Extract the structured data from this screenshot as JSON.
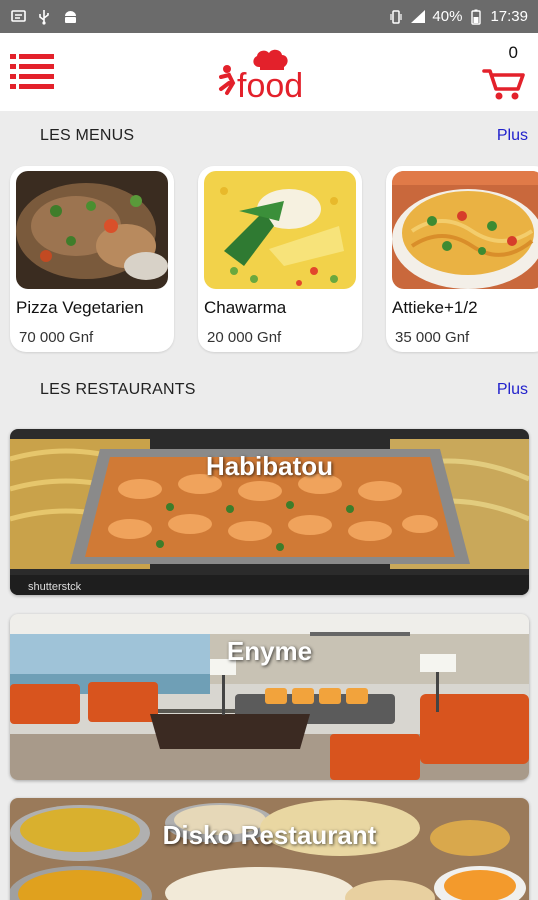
{
  "status_bar": {
    "battery": "40%",
    "time": "17:39"
  },
  "header": {
    "logo_text": "food",
    "cart_count": "0"
  },
  "sections": {
    "menus_title": "LES MENUS",
    "menus_more": "Plus",
    "restaurants_title": "LES RESTAURANTS",
    "restaurants_more": "Plus"
  },
  "menus": [
    {
      "name": "Pizza Vegetarien",
      "price": "70 000 Gnf"
    },
    {
      "name": "Chawarma",
      "price": "20 000 Gnf"
    },
    {
      "name": "Attieke+1/2",
      "price": "35 000 Gnf"
    }
  ],
  "restaurants": [
    {
      "name": "Habibatou",
      "watermark": "shutterstck"
    },
    {
      "name": "Enyme"
    },
    {
      "name": "Disko Restaurant"
    }
  ],
  "colors": {
    "brand_red": "#e3212b",
    "link_blue": "#2222cc"
  }
}
